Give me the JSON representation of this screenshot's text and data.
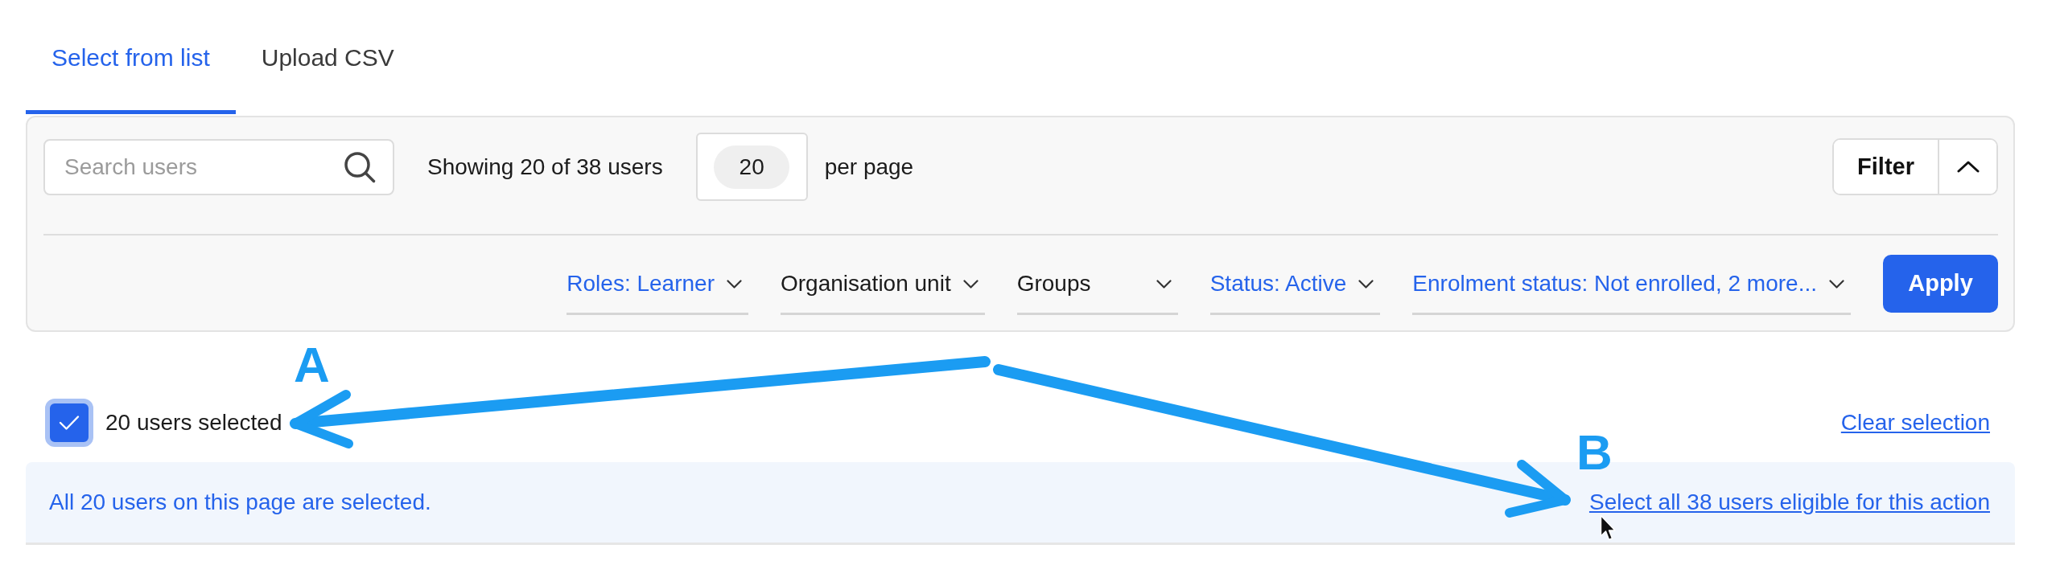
{
  "tabs": [
    {
      "label": "Select from list",
      "selected": true
    },
    {
      "label": "Upload CSV",
      "selected": false
    }
  ],
  "toolbar": {
    "search": {
      "placeholder": "Search users"
    },
    "result_count": "Showing 20 of 38 users",
    "page_size": {
      "value": "20",
      "label": "per page"
    },
    "filter": {
      "label": "Filter",
      "expanded": true
    }
  },
  "filters": [
    {
      "label": "Roles: Learner",
      "applied": true
    },
    {
      "label": "Organisation unit",
      "applied": false
    },
    {
      "label": "Groups",
      "applied": false
    },
    {
      "label": "Status: Active",
      "applied": true
    },
    {
      "label": "Enrolment status: Not enrolled, 2 more...",
      "applied": true
    }
  ],
  "apply_button": "Apply",
  "selection": {
    "checked": true,
    "label": "20 users selected",
    "clear_link": "Clear selection"
  },
  "banner": {
    "message": "All 20 users on this page are selected.",
    "select_all_link": "Select all 38 users eligible for this action"
  },
  "annotations": [
    {
      "label": "A"
    },
    {
      "label": "B"
    }
  ]
}
